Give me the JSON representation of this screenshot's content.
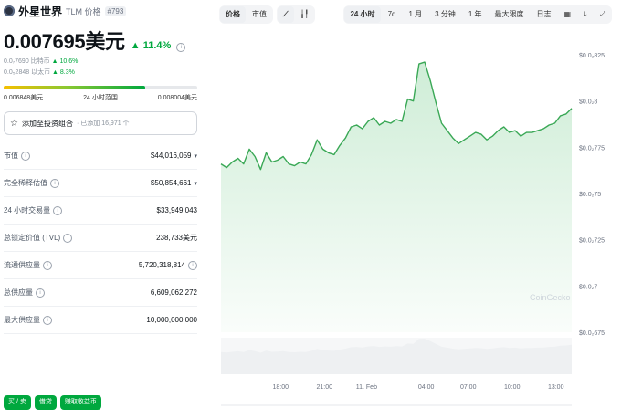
{
  "coin": {
    "name": "外星世界",
    "symbol": "TLM 价格",
    "rank": "#793",
    "price": "0.007695美元",
    "change": "▲ 11.4%",
    "btc_line": "0.0₇7690 比特币",
    "btc_change": "▲ 10.6%",
    "eth_line": "0.0₅2848 以太币",
    "eth_change": "▲ 8.3%"
  },
  "range24h": {
    "low": "0.006848美元",
    "label": "24 小时范围",
    "high": "0.008004美元",
    "position": 0.73
  },
  "portfolio": {
    "label": "添加至投资组合",
    "meta": "· 已添加 16,971 个"
  },
  "stats": [
    {
      "label": "市值",
      "value": "$44,016,059",
      "chevron": true
    },
    {
      "label": "完全稀释估值",
      "value": "$50,854,661",
      "chevron": true
    },
    {
      "label": "24 小时交易量",
      "value": "$33,949,043",
      "chevron": false
    },
    {
      "label": "总锁定价值 (TVL)",
      "value": "238,733美元",
      "chevron": false
    },
    {
      "label": "流通供应量",
      "value": "5,720,318,814",
      "chevron": false
    },
    {
      "label": "总供应量",
      "value": "6,609,062,272",
      "chevron": false
    },
    {
      "label": "最大供应量",
      "value": "10,000,000,000",
      "chevron": false
    }
  ],
  "bottom_buttons": [
    "买 / 卖",
    "借贷",
    "赚取收益币"
  ],
  "toolbar": {
    "price_tab": "价格",
    "mcap_tab": "市值",
    "line_icon": "line-chart-icon",
    "candle_icon": "candlestick-icon"
  },
  "ranges": [
    "24 小时",
    "7d",
    "1 月",
    "3 分钟",
    "1 年",
    "最大限度",
    "日志"
  ],
  "range_icons": [
    "calendar-icon",
    "download-icon",
    "expand-icon"
  ],
  "colors": {
    "green": "#00a83e",
    "line": "#3aa856",
    "area": "#c9ebd2"
  },
  "chart_data": {
    "type": "line",
    "series": [
      {
        "values": [
          0.00766,
          0.00764,
          0.00767,
          0.00769,
          0.00766,
          0.00774,
          0.0077,
          0.00763,
          0.00772,
          0.00767,
          0.00768,
          0.0077,
          0.00766,
          0.00765,
          0.00767,
          0.00766,
          0.00771,
          0.00779,
          0.00774,
          0.00772,
          0.00771,
          0.00776,
          0.0078,
          0.00786,
          0.00787,
          0.00785,
          0.00789,
          0.00791,
          0.00787,
          0.00789,
          0.00788,
          0.0079,
          0.00789,
          0.00801,
          0.008,
          0.0082,
          0.00821,
          0.00811,
          0.00799,
          0.00788,
          0.00784,
          0.0078,
          0.00777,
          0.00779,
          0.00781,
          0.00783,
          0.00782,
          0.00779,
          0.00781,
          0.00784,
          0.00786,
          0.00783,
          0.00784,
          0.00781,
          0.00783,
          0.00783,
          0.00784,
          0.00785,
          0.00787,
          0.00788,
          0.00792,
          0.00793,
          0.00796
        ]
      }
    ],
    "x_ticks": [
      "18:00",
      "21:00",
      "11. Feb",
      "04:00",
      "07:00",
      "10:00",
      "13:00"
    ],
    "y_ticks": [
      "$0.0₂825",
      "$0.0₂8",
      "$0.0₂775",
      "$0.0₂75",
      "$0.0₂725",
      "$0.0₂7",
      "$0.0₂675"
    ],
    "y_values": [
      0.00825,
      0.008,
      0.00775,
      0.0075,
      0.00725,
      0.007,
      0.00675
    ],
    "ylim": [
      0.00675,
      0.00825
    ],
    "watermark": "CoinGecko"
  }
}
